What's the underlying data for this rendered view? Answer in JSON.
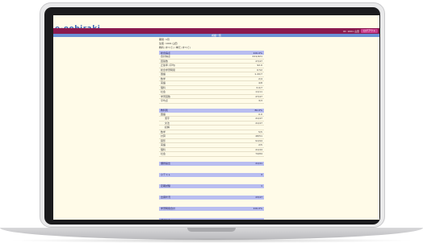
{
  "header": {
    "brand": "e-oobiraki",
    "brand_sub": "manabi",
    "user": "ID: 1001 山田",
    "logout": "ログアウト"
  },
  "page": {
    "title": "成績一覧"
  },
  "info": [
    "期間: 1月",
    "生徒: 1001 山田",
    "教科 (すべて) / 単元 (すべて)"
  ],
  "sections": [
    {
      "head": {
        "label": "総合得点",
        "value": "100.0%"
      },
      "rows": [
        {
          "label": "合計得点",
          "value": "421/421",
          "indent": false
        },
        {
          "label": "回答数",
          "value": "47/47",
          "indent": false
        },
        {
          "label": "正答率 (平均)",
          "value": "92.0",
          "indent": false
        },
        {
          "label": "総合学習時間",
          "value": "0:52",
          "indent": false
        },
        {
          "label": "国語",
          "value": "1.20/7",
          "indent": false
        },
        {
          "label": "数学",
          "value": "2/4",
          "indent": false
        },
        {
          "label": "英語",
          "value": "4/8",
          "indent": false
        },
        {
          "label": "理科",
          "value": "3.0/7",
          "indent": false
        },
        {
          "label": "社会",
          "value": "11/11",
          "indent": false
        },
        {
          "label": "学習回数",
          "value": "47/47",
          "indent": false
        },
        {
          "label": "平均点",
          "value": "3/3",
          "indent": false
        }
      ]
    },
    {
      "head": {
        "label": "教科別",
        "value": "80.0%"
      },
      "rows": [
        {
          "label": "国語",
          "value": "0.0",
          "indent": false
        },
        {
          "label": "漢字",
          "value": "41/47",
          "indent": true
        },
        {
          "label": "文法",
          "value": "41/47",
          "indent": true
        },
        {
          "label": "読解",
          "value": "",
          "indent": true
        },
        {
          "label": "数学",
          "value": "5/5",
          "indent": false
        },
        {
          "label": "計算",
          "value": "48/51",
          "indent": false
        },
        {
          "label": "図形",
          "value": "91/94",
          "indent": false
        },
        {
          "label": "英語",
          "value": "2/5",
          "indent": false
        },
        {
          "label": "理科",
          "value": "41/44",
          "indent": false
        },
        {
          "label": "社会",
          "value": "74/84",
          "indent": false
        }
      ]
    }
  ],
  "collapsed_sections": [
    {
      "label": "課題提出",
      "value": "41/41"
    },
    {
      "label": "小テスト",
      "value": "3"
    },
    {
      "label": "定期試験",
      "value": "1"
    },
    {
      "label": "出席状況",
      "value": "43/47"
    },
    {
      "label": "学習時間合計",
      "value": "100.0%"
    },
    {
      "label": "コメント",
      "value": ""
    }
  ]
}
